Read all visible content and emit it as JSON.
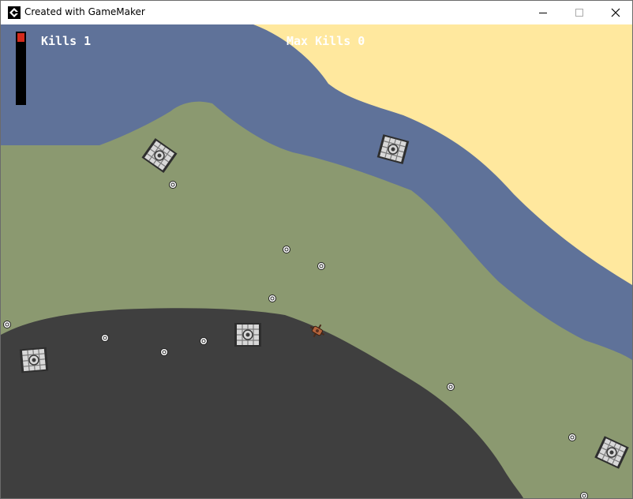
{
  "window": {
    "title": "Created with GameMaker",
    "app_icon": "gamemaker-logo-icon",
    "controls": [
      "minimize-icon",
      "maximize-icon",
      "close-icon"
    ]
  },
  "hud": {
    "health_fraction": 0.12,
    "kills_label": "Kills 1",
    "max_kills_label": "Max Kills 0"
  },
  "colors": {
    "sand": "#ffe89e",
    "water": "#5f7299",
    "grass": "#8b9970",
    "rock": "#3f3f3f",
    "health": "#d42a1c",
    "tank": "#d8d8d8",
    "player": "#b4643c"
  },
  "entities": {
    "enemy_tanks": 5,
    "player_ship": 1,
    "pickups": 12
  }
}
